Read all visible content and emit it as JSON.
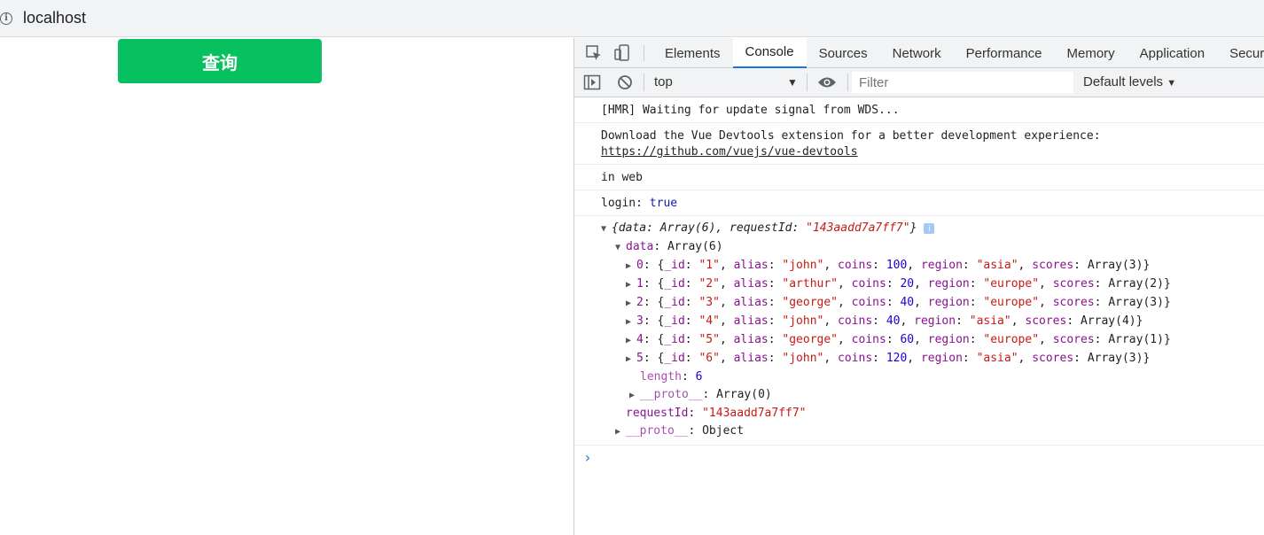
{
  "browser": {
    "url": "localhost"
  },
  "page": {
    "query_button": "查询"
  },
  "devtools": {
    "tabs": [
      "Elements",
      "Console",
      "Sources",
      "Network",
      "Performance",
      "Memory",
      "Application",
      "Secur"
    ],
    "active_tab": "Console",
    "toolbar": {
      "context": "top",
      "filter_placeholder": "Filter",
      "levels": "Default levels"
    }
  },
  "console": {
    "hmr": "[HMR] Waiting for update signal from WDS...",
    "vue_msg": "Download the Vue Devtools extension for a better development experience:",
    "vue_link": "https://github.com/vuejs/vue-devtools",
    "in_web": "in web",
    "login_key": "login:",
    "login_val": "true",
    "object": {
      "summary_prefix": "{data: Array(6), requestId: ",
      "summary_id": "\"143aadd7a7ff7\"",
      "summary_suffix": "}",
      "data_key": "data",
      "data_val": ": Array(6)",
      "items": [
        {
          "idx": "0",
          "id": "\"1\"",
          "alias": "\"john\"",
          "coins": "100",
          "region": "\"asia\"",
          "scores": "Array(3)"
        },
        {
          "idx": "1",
          "id": "\"2\"",
          "alias": "\"arthur\"",
          "coins": "20",
          "region": "\"europe\"",
          "scores": "Array(2)"
        },
        {
          "idx": "2",
          "id": "\"3\"",
          "alias": "\"george\"",
          "coins": "40",
          "region": "\"europe\"",
          "scores": "Array(3)"
        },
        {
          "idx": "3",
          "id": "\"4\"",
          "alias": "\"john\"",
          "coins": "40",
          "region": "\"asia\"",
          "scores": "Array(4)"
        },
        {
          "idx": "4",
          "id": "\"5\"",
          "alias": "\"george\"",
          "coins": "60",
          "region": "\"europe\"",
          "scores": "Array(1)"
        },
        {
          "idx": "5",
          "id": "\"6\"",
          "alias": "\"john\"",
          "coins": "120",
          "region": "\"asia\"",
          "scores": "Array(3)"
        }
      ],
      "length_key": "length",
      "length_val": "6",
      "proto_key": "__proto__",
      "array_proto_val": ": Array(0)",
      "requestId_key": "requestId",
      "requestId_val": "\"143aadd7a7ff7\"",
      "object_proto_val": ": Object"
    }
  },
  "colors": {
    "button_green": "#07c160",
    "active_tab": "#1a73e8"
  }
}
